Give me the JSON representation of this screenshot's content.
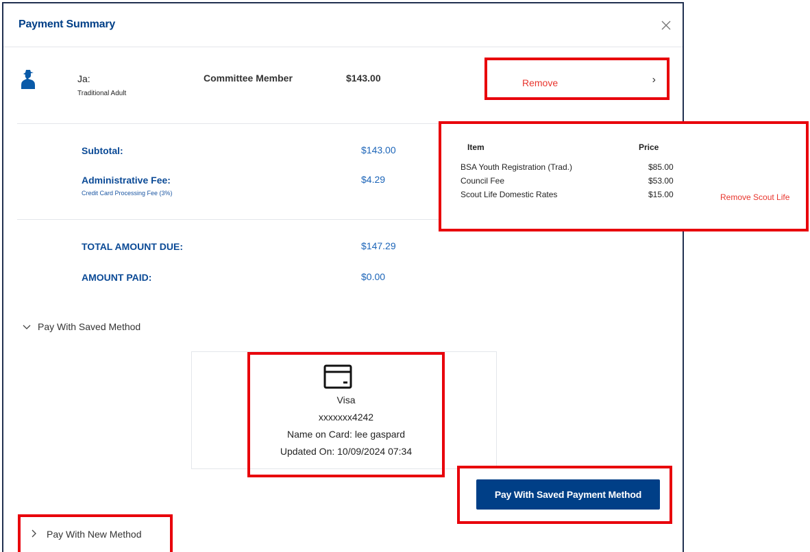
{
  "modal": {
    "title": "Payment Summary"
  },
  "member": {
    "name": "Ja:",
    "type": "Traditional Adult",
    "position": "Committee Member",
    "price": "$143.00",
    "remove_label": "Remove"
  },
  "totals": {
    "subtotal_label": "Subtotal:",
    "subtotal_value": "$143.00",
    "admin_fee_label": "Administrative Fee:",
    "admin_fee_sub": "Credit Card Processing Fee (3%)",
    "admin_fee_value": "$4.29",
    "total_due_label": "TOTAL AMOUNT DUE:",
    "total_due_value": "$147.29",
    "amount_paid_label": "AMOUNT PAID:",
    "amount_paid_value": "$0.00"
  },
  "price_breakdown": {
    "header_item": "Item",
    "header_price": "Price",
    "rows": [
      {
        "item": "BSA Youth Registration (Trad.)",
        "price": "$85.00"
      },
      {
        "item": "Council Fee",
        "price": "$53.00"
      },
      {
        "item": "Scout Life Domestic Rates",
        "price": "$15.00"
      }
    ],
    "remove_scout_life": "Remove Scout Life"
  },
  "saved_method": {
    "section_label": "Pay With Saved Method",
    "card_brand": "Visa",
    "card_number": "xxxxxxx4242",
    "name_on_card": "Name on Card: lee gaspard",
    "updated_on": "Updated On: 10/09/2024 07:34",
    "pay_button": "Pay With Saved Payment Method"
  },
  "new_method": {
    "section_label": "Pay With New Method"
  },
  "icons": {
    "close": "close-icon",
    "member": "scout-silhouette-icon",
    "card": "credit-card-icon",
    "chevron_right": "chevron-right-icon",
    "chevron_down": "chevron-down-icon"
  },
  "colors": {
    "brand_blue": "#003f87",
    "label_blue": "#0b4a96",
    "value_blue": "#1b64b8",
    "highlight_red": "#e8000b",
    "remove_red": "#e8342c"
  }
}
